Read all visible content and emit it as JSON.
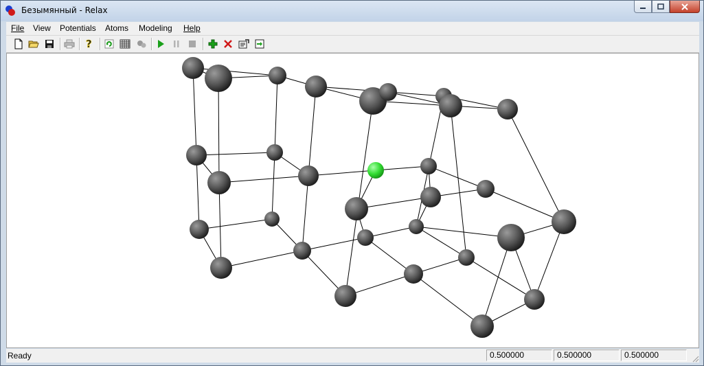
{
  "window": {
    "title": "Безымянный - Relax"
  },
  "menu": {
    "items": [
      {
        "label": "File"
      },
      {
        "label": "View"
      },
      {
        "label": "Potentials"
      },
      {
        "label": "Atoms"
      },
      {
        "label": "Modeling"
      },
      {
        "label": "Help"
      }
    ]
  },
  "toolbar": {
    "buttons": [
      {
        "icon": "new-file-icon"
      },
      {
        "icon": "open-folder-icon"
      },
      {
        "icon": "save-icon"
      },
      {
        "icon": "print-icon"
      },
      {
        "icon": "help-icon"
      },
      {
        "icon": "refresh-icon"
      },
      {
        "icon": "grid-icon"
      },
      {
        "icon": "gears-icon"
      },
      {
        "icon": "play-icon"
      },
      {
        "icon": "pause-icon"
      },
      {
        "icon": "stop-icon"
      },
      {
        "icon": "add-atom-icon"
      },
      {
        "icon": "delete-atom-icon"
      },
      {
        "icon": "properties-icon"
      },
      {
        "icon": "export-icon"
      }
    ]
  },
  "status": {
    "text": "Ready",
    "values": [
      "0.500000",
      "0.500000",
      "0.500000"
    ]
  },
  "colors": {
    "atom": "#555555",
    "selected_atom": "#33dd33",
    "bond": "#000000"
  }
}
